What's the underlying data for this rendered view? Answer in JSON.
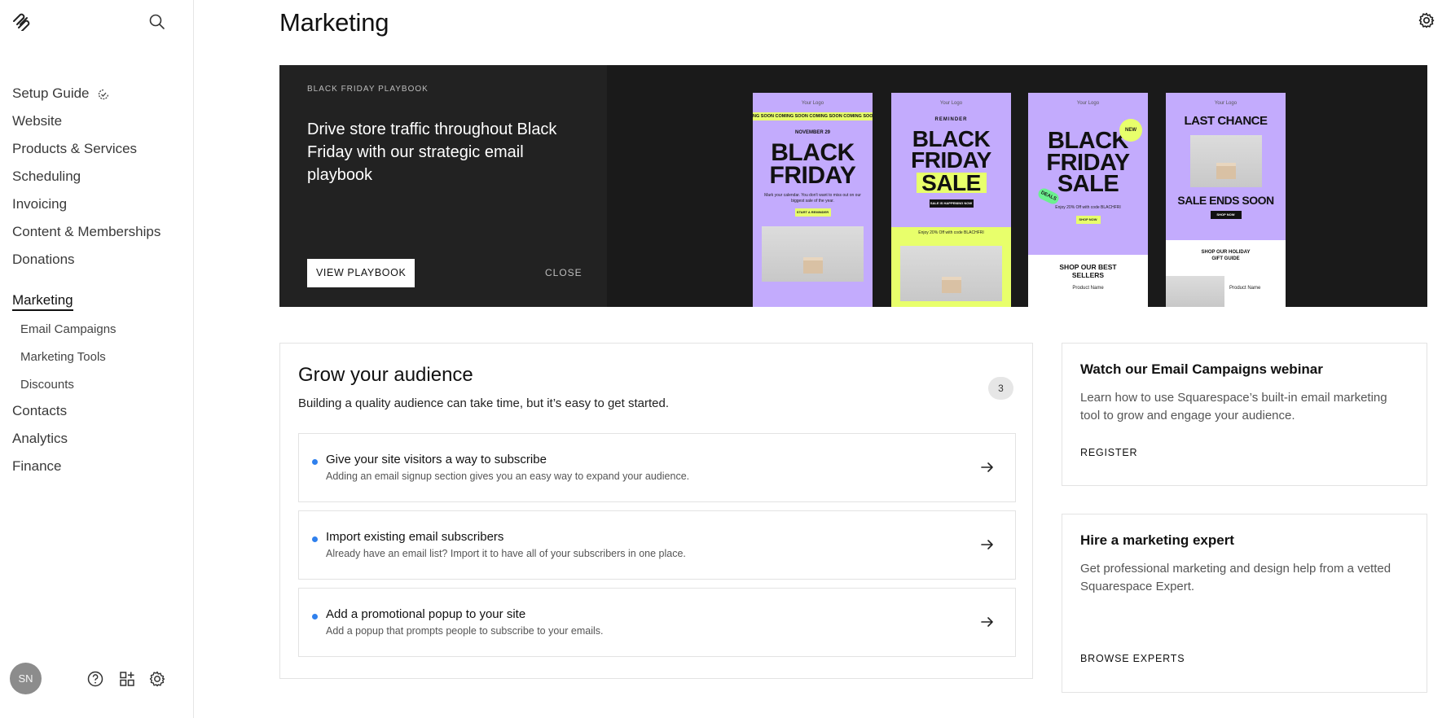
{
  "sidebar": {
    "user_initials": "SN",
    "items": [
      {
        "label": "Setup Guide"
      },
      {
        "label": "Website"
      },
      {
        "label": "Products & Services"
      },
      {
        "label": "Scheduling"
      },
      {
        "label": "Invoicing"
      },
      {
        "label": "Content & Memberships"
      },
      {
        "label": "Donations"
      },
      {
        "label": "Marketing",
        "active": true
      },
      {
        "label": "Contacts"
      },
      {
        "label": "Analytics"
      },
      {
        "label": "Finance"
      }
    ],
    "sub_items": [
      {
        "label": "Email Campaigns"
      },
      {
        "label": "Marketing Tools"
      },
      {
        "label": "Discounts"
      }
    ]
  },
  "page": {
    "title": "Marketing"
  },
  "banner": {
    "eyebrow": "BLACK FRIDAY PLAYBOOK",
    "heading": "Drive store traffic throughout Black Friday with our strategic email playbook",
    "view_button": "VIEW PLAYBOOK",
    "close_button": "CLOSE",
    "emails": [
      {
        "logo": "Your Logo",
        "ticker": "NG SOON   COMING SOON   COMING SOON   COMING SOON",
        "date": "NOVEMBER 29",
        "headline": "BLACK FRIDAY",
        "desc": "Mark your calendar. You don't want to miss out on our biggest sale of the year.",
        "cta": "START A REMINDER"
      },
      {
        "logo": "Your Logo",
        "eyebrow": "REMINDER",
        "headline1": "BLACK FRIDAY",
        "headline2": "SALE",
        "cta": "SALE IS HAPPENING NOW",
        "desc": "Enjoy 20% Off with code BLACHFRI"
      },
      {
        "logo": "Your Logo",
        "badge_new": "NEW",
        "badge_deals": "DEALS",
        "headline": "BLACK FRIDAY SALE",
        "desc": "Enjoy 20% Off with code BLACHFRI",
        "cta": "SHOP NOW",
        "section": "SHOP OUR BEST SELLERS",
        "product": "Product Name"
      },
      {
        "logo": "Your Logo",
        "headline": "LAST CHANCE",
        "headline2": "SALE ENDS SOON",
        "cta": "SHOP NOW",
        "section": "SHOP OUR HOLIDAY GIFT GUIDE",
        "product": "Product Name"
      }
    ]
  },
  "grow": {
    "title": "Grow your audience",
    "subtitle": "Building a quality audience can take time, but it’s easy to get started.",
    "count": "3",
    "tasks": [
      {
        "title": "Give your site visitors a way to subscribe",
        "desc": "Adding an email signup section gives you an easy way to expand your audience."
      },
      {
        "title": "Import existing email subscribers",
        "desc": "Already have an email list? Import it to have all of your subscribers in one place."
      },
      {
        "title": "Add a promotional popup to your site",
        "desc": "Add a popup that prompts people to subscribe to your emails."
      }
    ]
  },
  "webinar": {
    "title": "Watch our Email Campaigns webinar",
    "body": "Learn how to use Squarespace’s built-in email marketing tool to grow and engage your audience.",
    "link": "REGISTER"
  },
  "expert": {
    "title": "Hire a marketing expert",
    "body": "Get professional marketing and design help from a vetted Squarespace Expert.",
    "link": "BROWSE EXPERTS"
  },
  "colors": {
    "banner_bg": "#1a1a1a",
    "email_purple": "#c3abfd",
    "email_yellow": "#e8ff6b",
    "task_dot": "#2f80ed"
  }
}
